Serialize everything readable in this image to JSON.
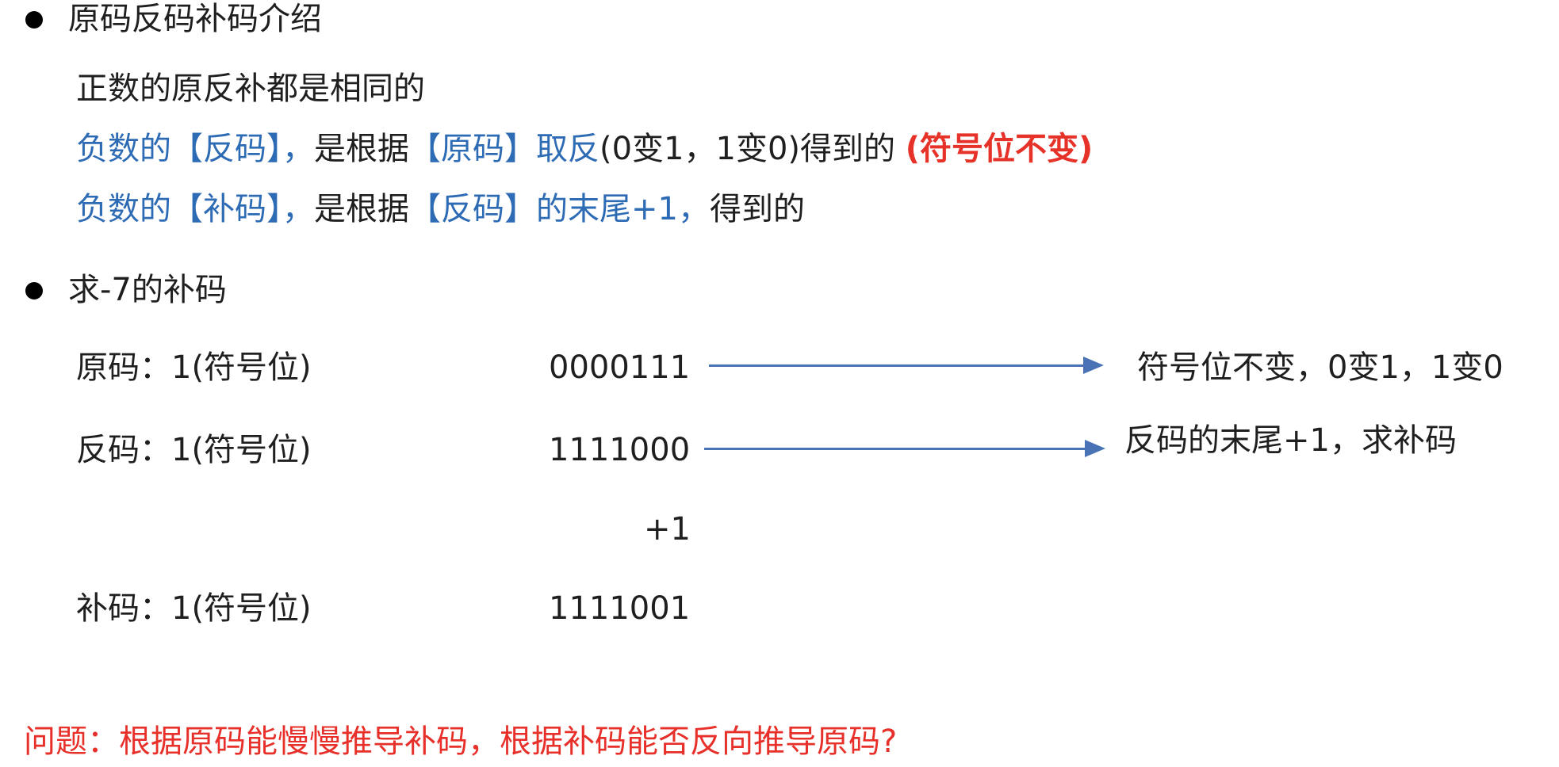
{
  "section1": {
    "heading": "原码反码补码介绍",
    "line1": "正数的原反补都是相同的",
    "line2_blue": "负数的【反码】，",
    "line2_dark1": "是根据",
    "line2_blue2": "【原码】取反",
    "line2_dark2": "(0变1，1变0)得到的",
    "line2_red": "(符号位不变)",
    "line3_blue": "负数的【补码】，",
    "line3_dark1": "是根据",
    "line3_blue2": "【反码】的末尾+1，",
    "line3_dark2": "得到的"
  },
  "section2": {
    "heading": "求-7的补码",
    "rows": [
      {
        "label": "原码：1(符号位)",
        "value": "0000111",
        "note": "符号位不变，0变1，1变0"
      },
      {
        "label": "反码：1(符号位)",
        "value": "1111000",
        "note": "反码的末尾+1，求补码"
      },
      {
        "label": "",
        "value": "+1",
        "note": ""
      },
      {
        "label": "补码：1(符号位)",
        "value": "1111001",
        "note": ""
      }
    ]
  },
  "question": "问题：根据原码能慢慢推导补码，根据补码能否反向推导原码?",
  "colors": {
    "blue_text": "#2e6bb5",
    "red_text": "#e8302a",
    "arrow": "#4a73b5"
  }
}
